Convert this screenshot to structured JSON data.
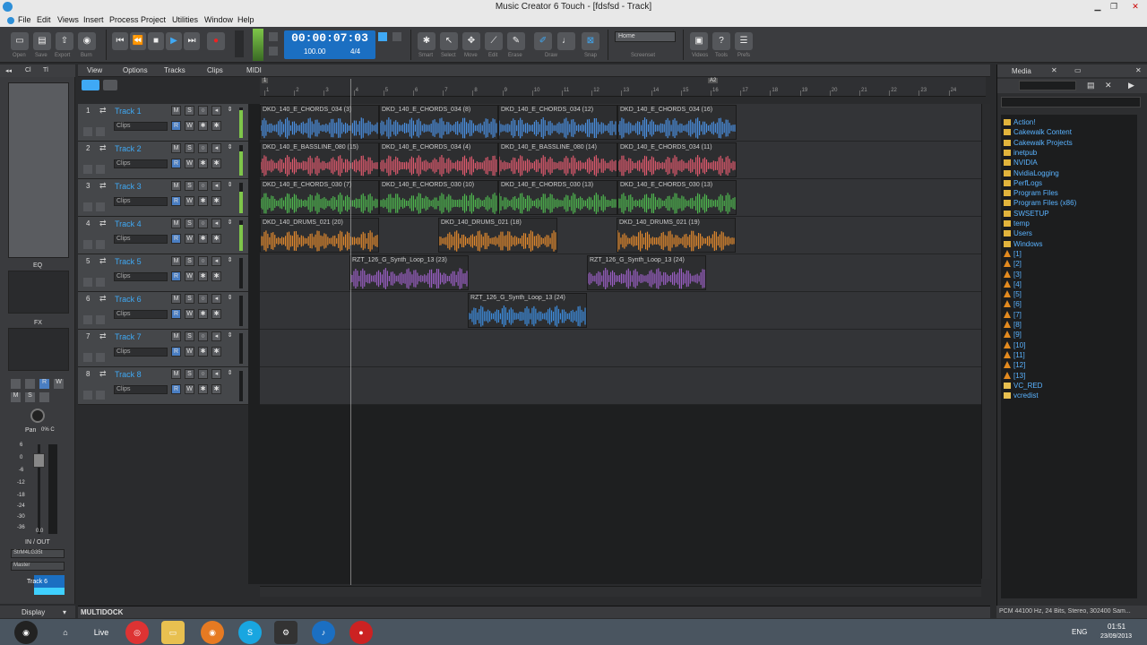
{
  "window": {
    "title": "Music Creator 6 Touch - [fdsfsd - Track]"
  },
  "menu": [
    "File",
    "Edit",
    "Views",
    "Insert",
    "Process",
    "Project",
    "Utilities",
    "Window",
    "Help"
  ],
  "toolbar": {
    "file_buttons": [
      "Open",
      "Save",
      "Export",
      "Burn"
    ],
    "time": "00:00:07:03",
    "tempo": "100.00",
    "meter": "4/4",
    "tools": [
      "Smart",
      "Select",
      "Move",
      "Edit",
      "Erase",
      "Draw",
      "Snap"
    ],
    "workspace": "Home",
    "workspace_label": "Screenset",
    "help_buttons": [
      "Videos",
      "Tools",
      "Prefs"
    ]
  },
  "inspector": {
    "tabs": [
      "◂◂",
      "Cl",
      "Tl"
    ],
    "eq_label": "EQ",
    "fx_label": "FX",
    "pan_label": "Pan",
    "pan_value": "0% C",
    "scale": [
      "6",
      "0",
      "-6",
      "-12",
      "-18",
      "-24",
      "-30",
      "-36"
    ],
    "fader_value": "0.0",
    "io_label": "IN / OUT",
    "input": "StrM4LG35t",
    "output": "Master",
    "track_name": "Track 6",
    "display_label": "Display"
  },
  "trackview": {
    "menus": [
      "View",
      "Options",
      "Tracks",
      "Clips",
      "MIDI"
    ]
  },
  "ruler": {
    "ticks": [
      "1",
      "2",
      "3",
      "4",
      "5",
      "6",
      "7",
      "8",
      "9",
      "10",
      "11",
      "12",
      "13",
      "14",
      "15",
      "16",
      "17",
      "18",
      "19",
      "20",
      "21",
      "22",
      "23",
      "24"
    ],
    "markers": [
      "1",
      "A2"
    ]
  },
  "tracks": [
    {
      "num": "1",
      "name": "Track 1",
      "clips_label": "Clips",
      "meter": 0.9,
      "color": "#4a8fe0",
      "clips": [
        {
          "label": "DKD_140_E_CHORDS_034 (3)",
          "start": 0,
          "len": 133
        },
        {
          "label": "DKD_140_E_CHORDS_034 (8)",
          "start": 133,
          "len": 133
        },
        {
          "label": "DKD_140_E_CHORDS_034 (12)",
          "start": 266,
          "len": 133
        },
        {
          "label": "DKD_140_E_CHORDS_034 (16)",
          "start": 399,
          "len": 133
        }
      ]
    },
    {
      "num": "2",
      "name": "Track 2",
      "clips_label": "Clips",
      "meter": 0.8,
      "color": "#e05a6e",
      "clips": [
        {
          "label": "DKD_140_E_BASSLINE_080 (15)",
          "start": 0,
          "len": 133
        },
        {
          "label": "DKD_140_E_CHORDS_034 (4)",
          "start": 133,
          "len": 133
        },
        {
          "label": "DKD_140_E_BASSLINE_080 (14)",
          "start": 266,
          "len": 133
        },
        {
          "label": "DKD_140_E_CHORDS_034 (11)",
          "start": 399,
          "len": 133
        }
      ]
    },
    {
      "num": "3",
      "name": "Track 3",
      "clips_label": "Clips",
      "meter": 0.7,
      "color": "#4fb84f",
      "clips": [
        {
          "label": "DKD_140_E_CHORDS_030 (7)",
          "start": 0,
          "len": 133
        },
        {
          "label": "DKD_140_E_CHORDS_030 (10)",
          "start": 133,
          "len": 133
        },
        {
          "label": "DKD_140_E_CHORDS_030 (13)",
          "start": 266,
          "len": 133
        },
        {
          "label": "DKD_140_E_CHORDS_030 (13)",
          "start": 399,
          "len": 133
        }
      ]
    },
    {
      "num": "4",
      "name": "Track 4",
      "clips_label": "Clips",
      "meter": 0.85,
      "color": "#e38a2e",
      "clips": [
        {
          "label": "DKD_140_DRUMS_021 (20)",
          "start": 0,
          "len": 133
        },
        {
          "label": "DKD_140_DRUMS_021 (18)",
          "start": 199,
          "len": 133
        },
        {
          "label": "DKD_140_DRUMS_021 (19)",
          "start": 398,
          "len": 133
        }
      ]
    },
    {
      "num": "5",
      "name": "Track 5",
      "clips_label": "Clips",
      "meter": 0,
      "color": "#9a5fc4",
      "clips": [
        {
          "label": "RZT_126_G_Synth_Loop_13 (23)",
          "start": 100,
          "len": 133
        },
        {
          "label": "RZT_126_G_Synth_Loop_13 (24)",
          "start": 365,
          "len": 133
        }
      ]
    },
    {
      "num": "6",
      "name": "Track 6",
      "clips_label": "Clips",
      "meter": 0,
      "color": "#3e8ee0",
      "clips": [
        {
          "label": "RZT_126_G_Synth_Loop_13 (24)",
          "start": 232,
          "len": 133
        }
      ]
    },
    {
      "num": "7",
      "name": "Track 7",
      "clips_label": "Clips",
      "meter": 0,
      "color": "#888",
      "clips": []
    },
    {
      "num": "8",
      "name": "Track 8",
      "clips_label": "Clips",
      "meter": 0,
      "color": "#888",
      "clips": []
    }
  ],
  "browser": {
    "tab": "Media",
    "items": [
      {
        "label": "Action!",
        "type": "folder"
      },
      {
        "label": "Cakewalk Content",
        "type": "folder"
      },
      {
        "label": "Cakewalk Projects",
        "type": "folder"
      },
      {
        "label": "inetpub",
        "type": "folder"
      },
      {
        "label": "NVIDIA",
        "type": "folder"
      },
      {
        "label": "NvidiaLogging",
        "type": "folder"
      },
      {
        "label": "PerfLogs",
        "type": "folder"
      },
      {
        "label": "Program Files",
        "type": "folder"
      },
      {
        "label": "Program Files (x86)",
        "type": "folder"
      },
      {
        "label": "SWSETUP",
        "type": "folder"
      },
      {
        "label": "temp",
        "type": "folder"
      },
      {
        "label": "Users",
        "type": "folder"
      },
      {
        "label": "Windows",
        "type": "folder"
      },
      {
        "label": "[1]",
        "type": "cone"
      },
      {
        "label": "[2]",
        "type": "cone"
      },
      {
        "label": "[3]",
        "type": "cone"
      },
      {
        "label": "[4]",
        "type": "cone"
      },
      {
        "label": "[5]",
        "type": "cone"
      },
      {
        "label": "[6]",
        "type": "cone"
      },
      {
        "label": "[7]",
        "type": "cone"
      },
      {
        "label": "[8]",
        "type": "cone"
      },
      {
        "label": "[9]",
        "type": "cone"
      },
      {
        "label": "[10]",
        "type": "cone"
      },
      {
        "label": "[11]",
        "type": "cone"
      },
      {
        "label": "[12]",
        "type": "cone"
      },
      {
        "label": "[13]",
        "type": "cone"
      },
      {
        "label": "VC_RED",
        "type": "file"
      },
      {
        "label": "vcredist",
        "type": "file"
      }
    ]
  },
  "multidock": "MULTIDOCK",
  "status": "PCM 44100 Hz, 24 Bits, Stereo, 302400 Sam...",
  "taskbar": {
    "items": [
      "Live"
    ],
    "lang": "ENG",
    "time": "01:51",
    "date": "23/09/2013"
  }
}
